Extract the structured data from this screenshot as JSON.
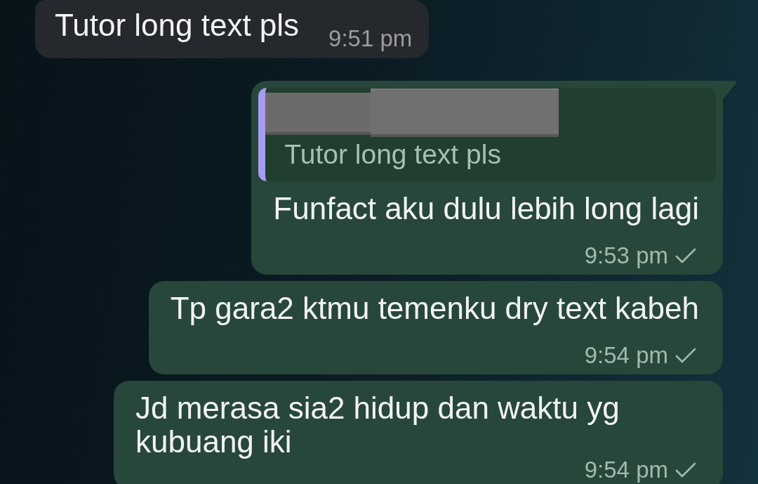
{
  "messages": [
    {
      "kind": "incoming",
      "text": "Tutor long text pls",
      "time": "9:51 pm",
      "tail": false
    },
    {
      "kind": "outgoing",
      "quote": {
        "text": "Tutor long text pls"
      },
      "text": "Funfact aku dulu lebih long lagi",
      "time": "9:53 pm",
      "sent": true,
      "tail": true
    },
    {
      "kind": "outgoing",
      "text": "Tp gara2 ktmu temenku dry text kabeh",
      "time": "9:54 pm",
      "sent": true,
      "tail": false
    },
    {
      "kind": "outgoing",
      "text": "Jd merasa sia2 hidup dan waktu yg kubuang iki",
      "time": "9:54 pm",
      "sent": true,
      "tail": false
    }
  ]
}
